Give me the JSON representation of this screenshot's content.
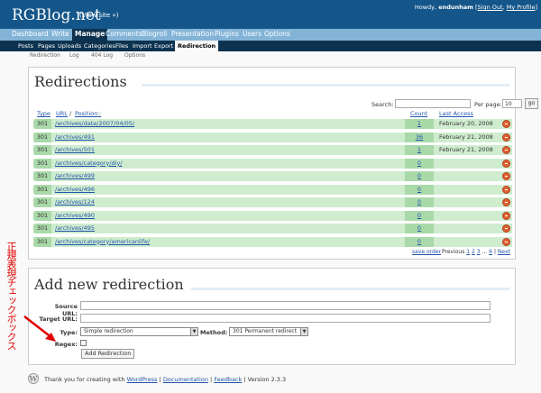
{
  "header": {
    "blog_title": "RGBlog.net",
    "view_site": "(View site »)",
    "howdy_prefix": "Howdy,",
    "username": "endunham",
    "sign_out": "Sign Out",
    "my_profile": "My Profile",
    "separator": ", ",
    "bracket_open": "[",
    "bracket_close": "]",
    "mid_separator": "|"
  },
  "admin_menu": {
    "dashboard": "Dashboard",
    "write": "Write",
    "manage": "Manage",
    "comments": "Comments",
    "blogroll": "Blogroll",
    "presentation": "Presentation",
    "plugins": "Plugins",
    "users": "Users",
    "options": "Options"
  },
  "sub_menu": {
    "posts": "Posts",
    "pages": "Pages",
    "uploads": "Uploads",
    "categories": "Categories",
    "files": "Files",
    "import": "Import",
    "export": "Export",
    "redirection": "Redirection"
  },
  "subsub_menu": {
    "redirection": "Redirection",
    "log": "Log",
    "log404": "404 Log",
    "options": "Options"
  },
  "redirections": {
    "title": "Redirections",
    "search_label": "Search:",
    "search_value": "",
    "perpage_label": "Per page:",
    "perpage_value": "10",
    "go_label": "go",
    "col_type": "Type",
    "col_url": "URL",
    "col_slash": "/",
    "col_position": "Position",
    "col_count": "Count",
    "col_last_access": "Last Access",
    "rows": [
      {
        "type": "301",
        "url": "/archives/date/2007/04/05/",
        "count": "1",
        "last": "February 20, 2008"
      },
      {
        "type": "301",
        "url": "/archives/491",
        "count": "36",
        "last": "February 21, 2008"
      },
      {
        "type": "301",
        "url": "/archives/501",
        "count": "1",
        "last": "February 21, 2008"
      },
      {
        "type": "301",
        "url": "/archives/category/diy/",
        "count": "0",
        "last": ""
      },
      {
        "type": "301",
        "url": "/archives/499",
        "count": "0",
        "last": ""
      },
      {
        "type": "301",
        "url": "/archives/496",
        "count": "0",
        "last": ""
      },
      {
        "type": "301",
        "url": "/archives/124",
        "count": "0",
        "last": ""
      },
      {
        "type": "301",
        "url": "/archives/490",
        "count": "0",
        "last": ""
      },
      {
        "type": "301",
        "url": "/archives/495",
        "count": "0",
        "last": ""
      },
      {
        "type": "301",
        "url": "/archives/category/americanlife/",
        "count": "0",
        "last": ""
      }
    ],
    "save_order": "save order",
    "previous": "Previous",
    "pages_1": "1",
    "pages_2": "2",
    "pages_3": "3",
    "ellipsis": "...",
    "pages_6": "6",
    "next": "Next",
    "pipe": "|"
  },
  "add_new": {
    "title": "Add new redirection",
    "source_label": "Source URL:",
    "source_value": "",
    "target_label": "Target URL:",
    "target_value": "",
    "type_label": "Type:",
    "type_value": "Simple redirection",
    "method_label": "Method:",
    "method_value": "301 Permanent redirect",
    "regex_label": "Regex:",
    "add_button": "Add Redirection"
  },
  "annotation": {
    "text": "正規表現チェックボックス",
    "color": "#e00000"
  },
  "footer": {
    "thanks": "Thank you for creating with",
    "wordpress": "WordPress",
    "documentation": "Documentation",
    "feedback": "Feedback",
    "version": "Version 2.3.3",
    "pipe": "|"
  }
}
